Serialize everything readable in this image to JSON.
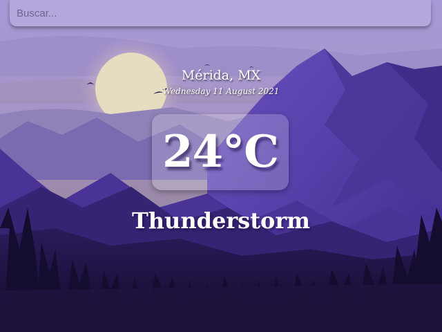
{
  "search": {
    "placeholder": "Buscar..."
  },
  "weather": {
    "location": "Mérida, MX",
    "date": "Wednesday 11 August 2021",
    "temperature": "24°C",
    "condition": "Thunderstorm"
  },
  "colors": {
    "sky_top": "#9c8fd0",
    "sky_mid": "#9a8ab0",
    "sun": "#e8dfc0",
    "mountain_far": "#8a7cc0",
    "mountain_mid": "#5a3fa8",
    "mountain_dark": "#3a2775",
    "forest": "#140c2e",
    "search_bar": "#b3a7dc",
    "text": "#ffffff"
  }
}
